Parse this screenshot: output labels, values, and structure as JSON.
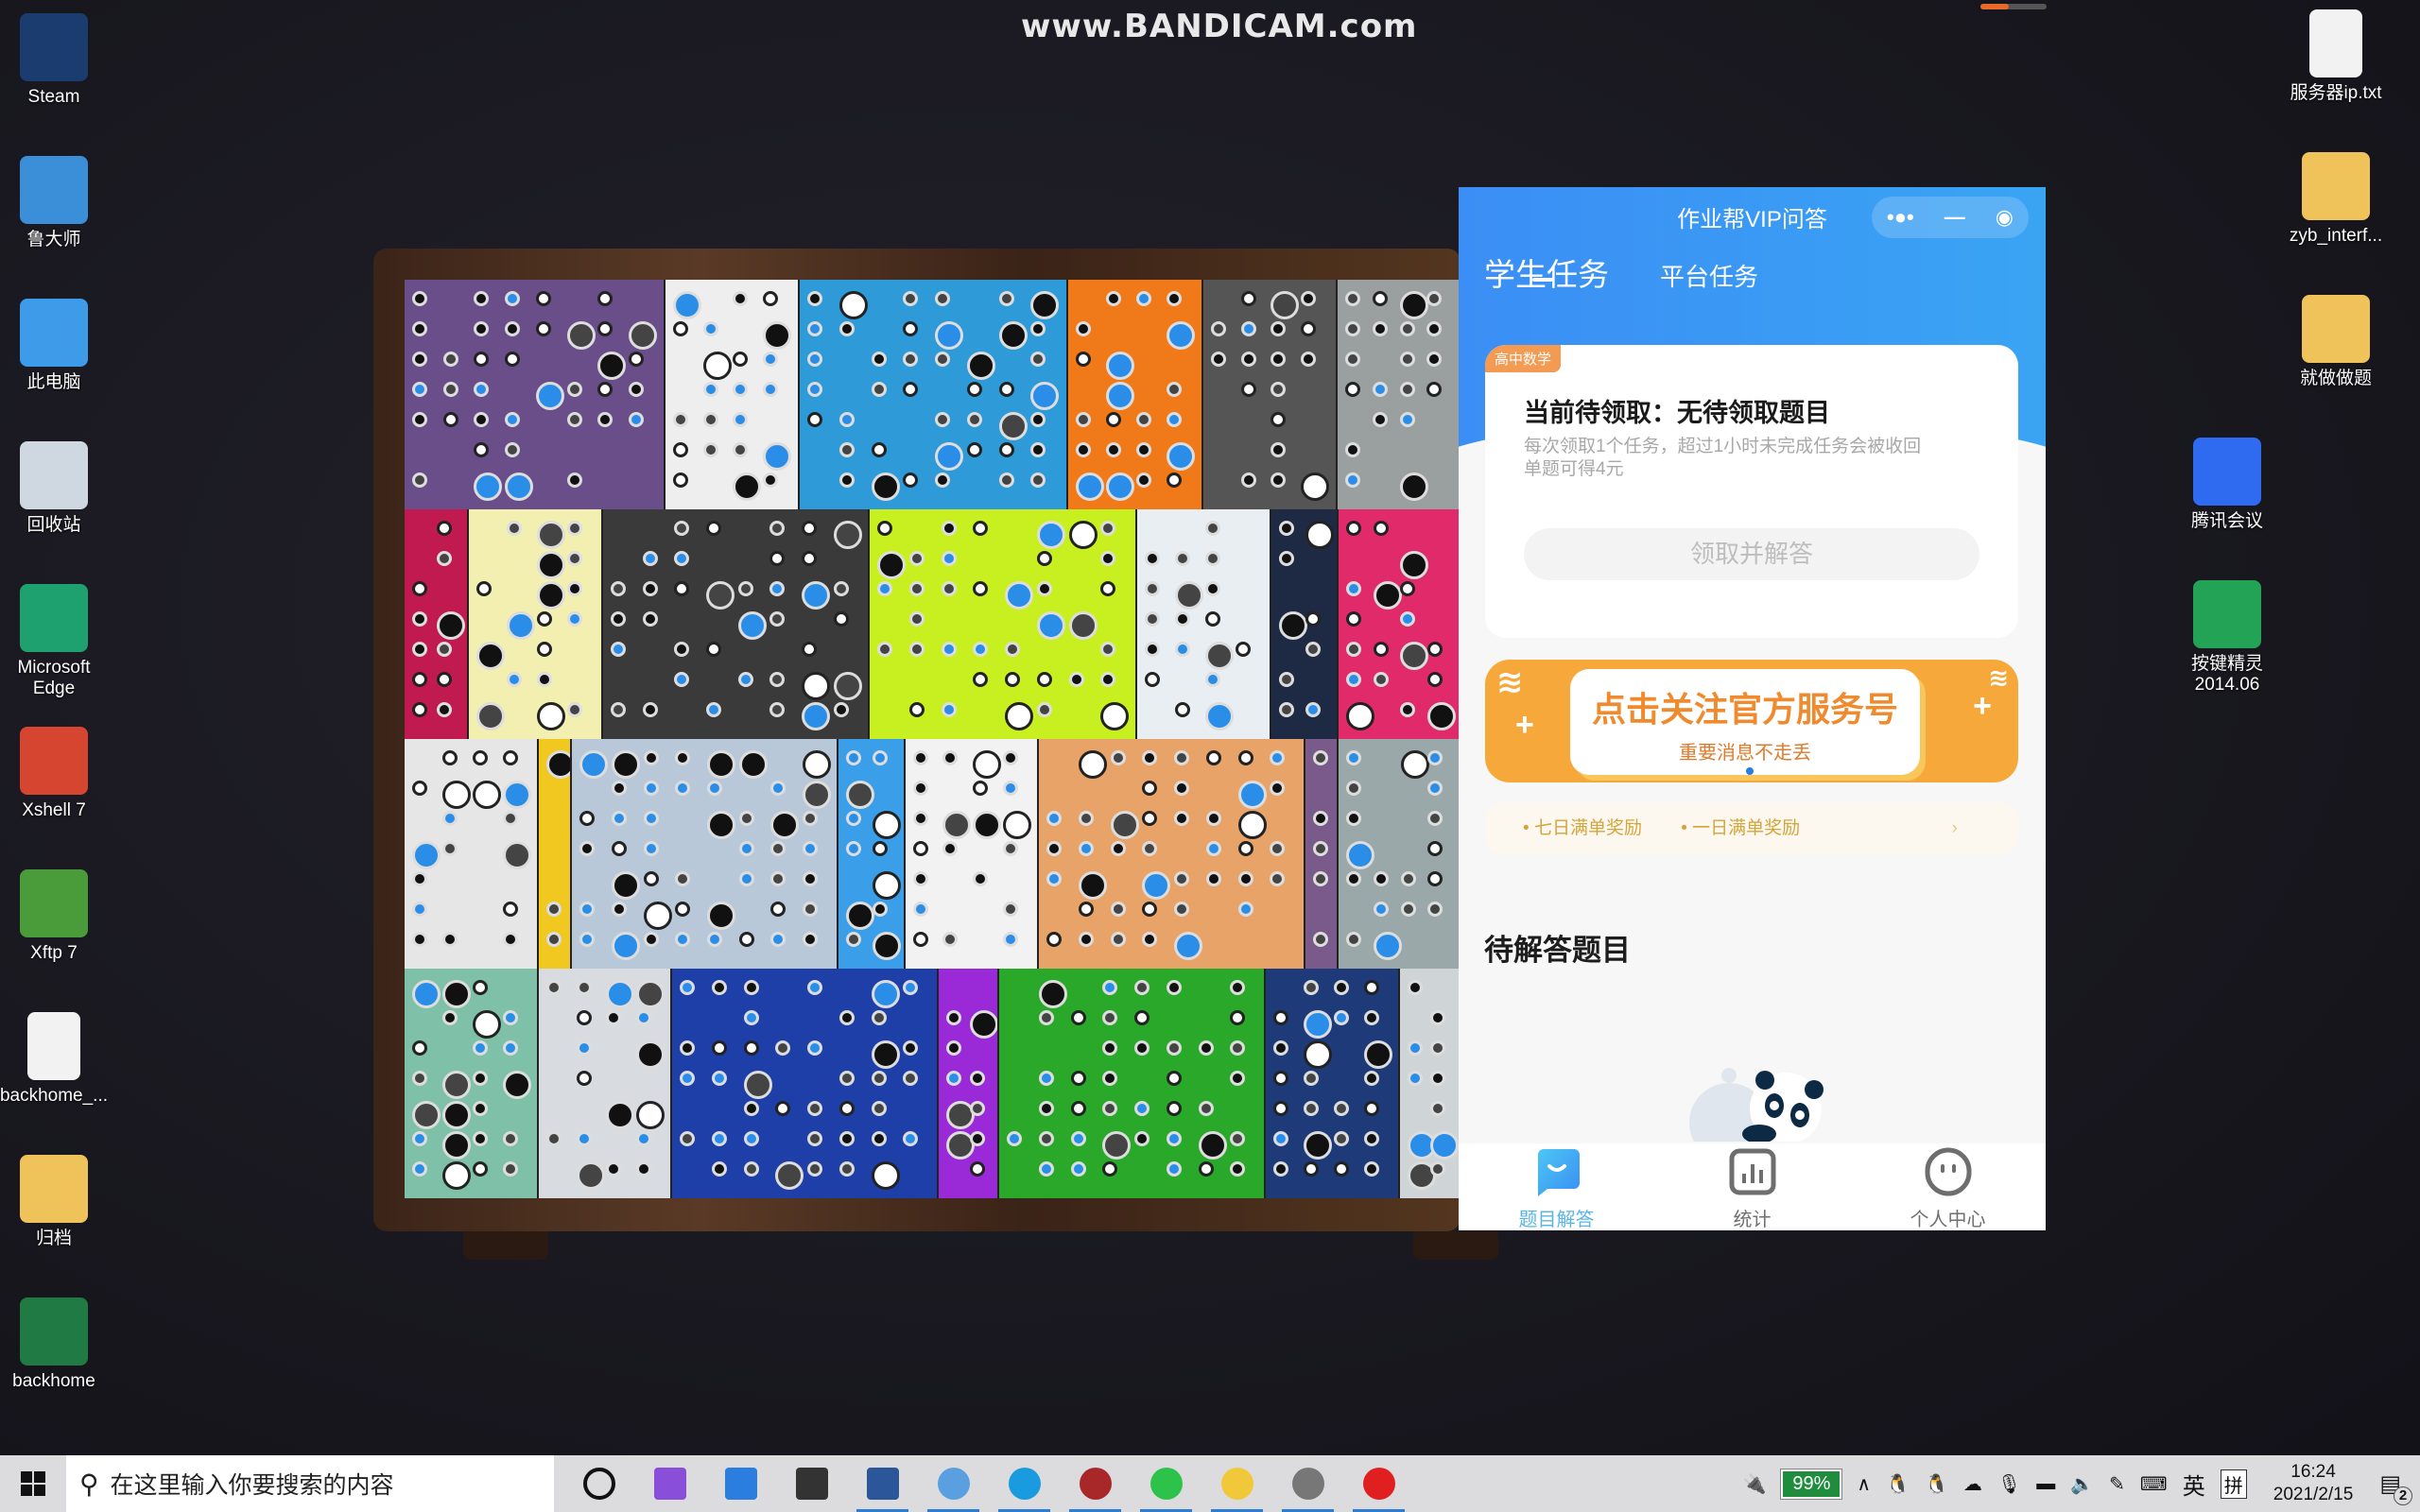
{
  "watermark": "www.BANDICAM.com",
  "desktop_icons_left": [
    {
      "label": "Steam",
      "icon": "steam-icon"
    },
    {
      "label": "鲁大师",
      "icon": "ludashi-icon"
    },
    {
      "label": "此电脑",
      "icon": "computer-icon"
    },
    {
      "label": "回收站",
      "icon": "recycle-bin-icon"
    },
    {
      "label": "Microsoft Edge",
      "icon": "edge-icon"
    },
    {
      "label": "Xshell 7",
      "icon": "xshell-icon"
    },
    {
      "label": "Xftp 7",
      "icon": "xftp-icon"
    },
    {
      "label": "backhome_...",
      "icon": "file-icon"
    },
    {
      "label": "归档",
      "icon": "folder-icon"
    },
    {
      "label": "backhome",
      "icon": "excel-file-icon"
    }
  ],
  "desktop_icons_right": [
    {
      "label": "服务器ip.txt",
      "icon": "text-file-icon"
    },
    {
      "label": "zyb_interf...",
      "icon": "folder-icon"
    },
    {
      "label": "就做做题",
      "icon": "archive-folder-icon"
    },
    {
      "label": "腾讯会议",
      "icon": "tencent-meeting-icon"
    },
    {
      "label": "按键精灵2014.06",
      "icon": "anjian-icon"
    }
  ],
  "miniapp": {
    "title": "作业帮VIP问答",
    "tabs": [
      {
        "label": "学生任务",
        "active": true
      },
      {
        "label": "平台任务",
        "active": false
      }
    ],
    "card": {
      "tag": "高中数学",
      "heading": "当前待领取：无待领取题目",
      "desc_line1": "每次领取1个任务，超过1小时未完成任务会被收回",
      "desc_line2": "单题可得4元",
      "button": "领取并解答"
    },
    "banner": {
      "title": "点击关注官方服务号",
      "subtitle": "重要消息不走丢"
    },
    "rewards": [
      "七日满单奖励",
      "一日满单奖励"
    ],
    "section_title": "待解答题目",
    "nav": [
      {
        "label": "题目解答",
        "icon": "chat-icon",
        "active": true
      },
      {
        "label": "统计",
        "icon": "chart-icon",
        "active": false
      },
      {
        "label": "个人中心",
        "icon": "profile-icon",
        "active": false
      }
    ],
    "colors": {
      "header": "#3b8ef5",
      "accent_orange": "#f6a93a",
      "active_nav": "#59b5e6"
    }
  },
  "taskbar": {
    "search_placeholder": "在这里输入你要搜索的内容",
    "apps": [
      "cortana-icon",
      "visual-studio-icon",
      "todo-icon",
      "terminal-icon",
      "word-icon",
      "app-icon",
      "edge-icon",
      "app-red-icon",
      "wechat-icon",
      "zuoyebang-icon",
      "java-icon",
      "bandicam-record-icon"
    ],
    "battery": "99%",
    "ime_lang": "英",
    "ime_mode": "拼",
    "time": "16:24",
    "date": "2021/2/15",
    "notifications": "2"
  }
}
